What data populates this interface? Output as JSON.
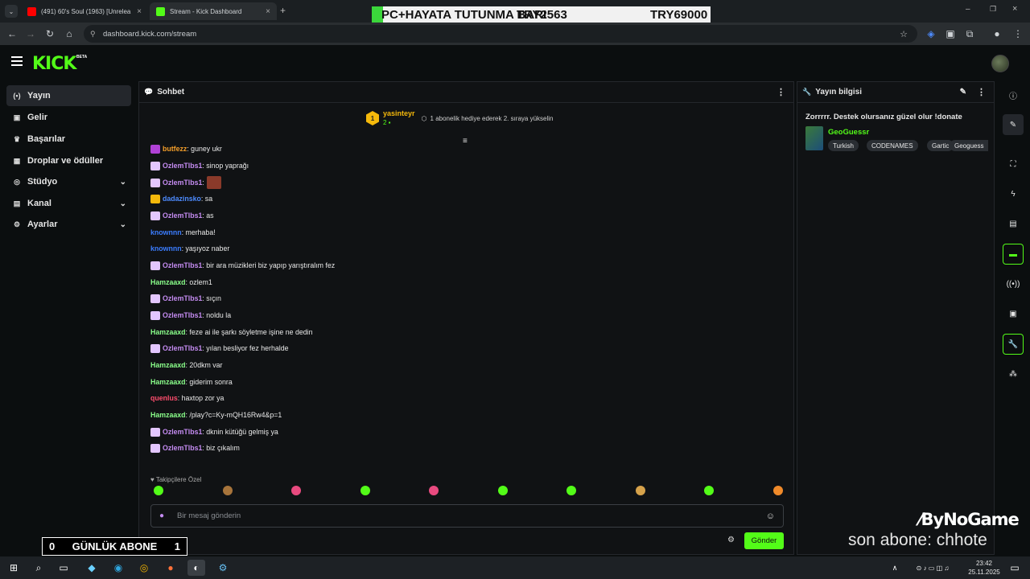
{
  "browser": {
    "tabs": [
      {
        "title": "(491) 60's Soul (1963) [Unrelea",
        "color": "#ff0000"
      },
      {
        "title": "Stream - Kick Dashboard",
        "color": "#53fc18"
      }
    ],
    "new_tab": "+",
    "url": "dashboard.kick.com/stream"
  },
  "overlay": {
    "banner_left": "PC+HAYATA TUTUNMA BARI",
    "banner_mid": "TRY2563",
    "banner_right": "TRY69000",
    "daily_sub_left": "0",
    "daily_sub_label": "GÜNLÜK ABONE",
    "daily_sub_right": "1",
    "sponsor": "ByNoGame",
    "last_sub": "son abone: chhote"
  },
  "kick": {
    "logo": "KICK",
    "beta": "BETA"
  },
  "sidebar": {
    "items": [
      {
        "label": "Yayın",
        "icon": "broadcast-icon",
        "glyph": "(•)"
      },
      {
        "label": "Gelir",
        "icon": "wallet-icon",
        "glyph": "▣"
      },
      {
        "label": "Başarılar",
        "icon": "trophy-icon",
        "glyph": "🏆"
      },
      {
        "label": "Droplar ve ödüller",
        "icon": "drops-icon",
        "glyph": "▦"
      },
      {
        "label": "Stüdyo",
        "icon": "studio-icon",
        "glyph": "◎"
      },
      {
        "label": "Kanal",
        "icon": "channel-icon",
        "glyph": "▤"
      },
      {
        "label": "Ayarlar",
        "icon": "settings-icon",
        "glyph": "⚙"
      }
    ]
  },
  "chat": {
    "title": "Sohbet",
    "pinned_user": "yasinteyr",
    "pinned_rank": "1",
    "pinned_count": "2",
    "pinned_message": "1 abonelik hediye ederek 2. sıraya yükselin",
    "messages": [
      {
        "user": "butfezz",
        "text": ": guney ukr",
        "color": "#f59f2a",
        "badge": "#b041d6"
      },
      {
        "user": "OzlemTlbs1",
        "text": ": sinop yaprağı",
        "color": "#c58cf2",
        "badge": "#e3c6ff"
      },
      {
        "user": "OzlemTlbs1",
        "text": ":",
        "color": "#c58cf2",
        "badge": "#e3c6ff"
      },
      {
        "user": "dadazinsko",
        "text": ": sa",
        "color": "#4d8bff",
        "badge": "#f5b90b"
      },
      {
        "user": "OzlemTlbs1",
        "text": ": as",
        "color": "#c58cf2",
        "badge": "#e3c6ff"
      },
      {
        "user": "knownnn",
        "text": ": merhaba!",
        "color": "#3b7dff",
        "badge": ""
      },
      {
        "user": "knownnn",
        "text": ": yaşıyoz naber",
        "color": "#3b7dff",
        "badge": ""
      },
      {
        "user": "OzlemTlbs1",
        "text": ": bir ara müzikleri biz yapıp yarıştıralım fez",
        "color": "#c58cf2",
        "badge": "#e3c6ff"
      },
      {
        "user": "Hamzaaxd",
        "text": ": ozlem1",
        "color": "#8aff8a",
        "badge": ""
      },
      {
        "user": "OzlemTlbs1",
        "text": ": sıçın",
        "color": "#c58cf2",
        "badge": "#e3c6ff"
      },
      {
        "user": "OzlemTlbs1",
        "text": ": noldu la",
        "color": "#c58cf2",
        "badge": "#e3c6ff"
      },
      {
        "user": "Hamzaaxd",
        "text": ": feze ai ile şarkı söyletme işine ne dedin",
        "color": "#8aff8a",
        "badge": ""
      },
      {
        "user": "OzlemTlbs1",
        "text": ": yılan besliyor fez herhalde",
        "color": "#c58cf2",
        "badge": "#e3c6ff"
      },
      {
        "user": "Hamzaaxd",
        "text": ": 20dkm var",
        "color": "#8aff8a",
        "badge": ""
      },
      {
        "user": "Hamzaaxd",
        "text": ": giderim sonra",
        "color": "#8aff8a",
        "badge": ""
      },
      {
        "user": "quenlus",
        "text": ": haxtop zor ya",
        "color": "#ff4d6d",
        "badge": ""
      },
      {
        "user": "Hamzaaxd",
        "text": ": /play?c=Ky-mQH16Rw4&p=1",
        "color": "#8aff8a",
        "badge": ""
      },
      {
        "user": "OzlemTlbs1",
        "text": ": dknin kütüğü gelmiş ya",
        "color": "#c58cf2",
        "badge": "#e3c6ff"
      },
      {
        "user": "OzlemTlbs1",
        "text": ": biz çıkalım",
        "color": "#c58cf2",
        "badge": "#e3c6ff"
      }
    ],
    "emote_section_label": "Takipçilere Özel",
    "input_placeholder": "Bir mesaj gönderin",
    "send_label": "Gönder"
  },
  "stream_info": {
    "title": "Yayın bilgisi",
    "stream_title": "Zorrrrr. Destek olursanız güzel olur !donate",
    "category": "GeoGuessr",
    "tags": [
      "Turkish",
      "CODENAMES",
      "Gartic",
      "Geoguess"
    ]
  },
  "taskbar": {
    "time": "23:42",
    "date": "25.11.2025"
  }
}
